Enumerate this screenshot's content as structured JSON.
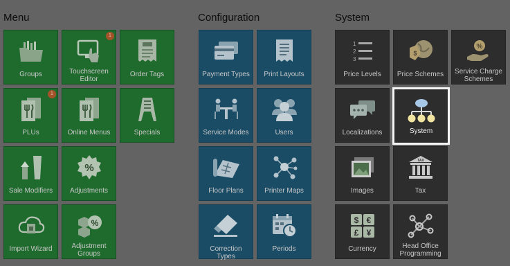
{
  "sections": {
    "menu": {
      "title": "Menu"
    },
    "configuration": {
      "title": "Configuration"
    },
    "system": {
      "title": "System"
    }
  },
  "tiles": {
    "groups": {
      "label": "Groups",
      "icon": "folder-icon"
    },
    "touchscreen_editor": {
      "label": "Touchscreen Editor",
      "icon": "touchscreen-icon",
      "badge": "1"
    },
    "order_tags": {
      "label": "Order Tags",
      "icon": "receipt-tag-icon"
    },
    "plus": {
      "label": "PLUs",
      "icon": "menu-card-icon",
      "badge": "1"
    },
    "online_menus": {
      "label": "Online Menus",
      "icon": "menu-card-icon"
    },
    "specials": {
      "label": "Specials",
      "icon": "board-sign-icon"
    },
    "sale_modifiers": {
      "label": "Sale Modifiers",
      "icon": "glass-arrow-icon"
    },
    "adjustments": {
      "label": "Adjustments",
      "icon": "percent-badge-icon"
    },
    "import_wizard": {
      "label": "Import Wizard",
      "icon": "cloud-upload-icon"
    },
    "adjustment_groups": {
      "label": "Adjustment Groups",
      "icon": "percent-tags-icon"
    },
    "payment_types": {
      "label": "Payment Types",
      "icon": "credit-card-icon"
    },
    "print_layouts": {
      "label": "Print Layouts",
      "icon": "receipt-icon"
    },
    "service_modes": {
      "label": "Service Modes",
      "icon": "dining-table-icon"
    },
    "users": {
      "label": "Users",
      "icon": "users-icon"
    },
    "floor_plans": {
      "label": "Floor Plans",
      "icon": "floor-plan-icon"
    },
    "printer_maps": {
      "label": "Printer Maps",
      "icon": "network-nodes-icon"
    },
    "correction_types": {
      "label": "Correction Types",
      "icon": "eraser-icon"
    },
    "periods": {
      "label": "Periods",
      "icon": "calendar-clock-icon"
    },
    "price_levels": {
      "label": "Price Levels",
      "icon": "numbered-list-icon"
    },
    "price_schemes": {
      "label": "Price Schemes",
      "icon": "price-globe-icon"
    },
    "service_charge_schemes": {
      "label": "Service Charge Schemes",
      "icon": "hand-percent-icon"
    },
    "localizations": {
      "label": "Localizations",
      "icon": "speech-bubbles-icon"
    },
    "system": {
      "label": "System",
      "icon": "hierarchy-icon"
    },
    "images": {
      "label": "Images",
      "icon": "picture-icon"
    },
    "tax": {
      "label": "Tax",
      "icon": "tax-building-icon"
    },
    "currency": {
      "label": "Currency",
      "icon": "currency-symbols-icon"
    },
    "head_office_programming": {
      "label": "Head Office Programming",
      "icon": "connected-nodes-icon"
    }
  },
  "selected_tile": "System",
  "colors": {
    "background": "#636363",
    "menu_tile": "#1f6a2d",
    "configuration_tile": "#1a4c66",
    "system_tile": "#2d2d2d",
    "selected_border": "#f4f4f4",
    "badge": "#a4522a"
  }
}
